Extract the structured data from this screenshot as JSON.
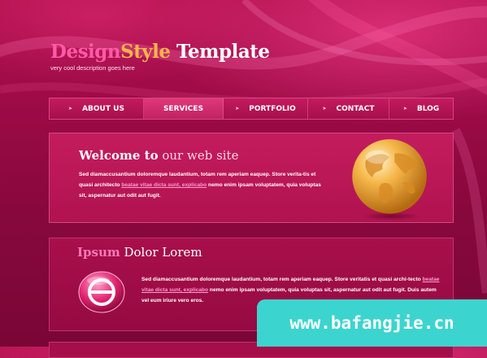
{
  "header": {
    "logo_part1": "Design",
    "logo_part2": "Style",
    "logo_part3": " Template",
    "tagline": "very cool description goes here"
  },
  "nav": {
    "items": [
      {
        "label": "ABOUT US"
      },
      {
        "label": "SERVICES",
        "active": true
      },
      {
        "label": "PORTFOLIO"
      },
      {
        "label": "CONTACT"
      },
      {
        "label": "BLOG"
      }
    ]
  },
  "welcome": {
    "title_bold": "Welcome to",
    "title_light": " our web site",
    "text_before": "Sed diamaccusantium doloremque laudantium, totam rem aperiam eaquep. Store verita-tis et quasi architecto ",
    "link": "beatae vitae dicta sunt, explicabo",
    "text_after": " nemo enim ipsam voluptatem, quia voluptas sit, aspernatur aut odit aut fugit."
  },
  "ipsum": {
    "title_bold": "Ipsum",
    "title_light": " Dolor Lorem",
    "text_before": "Sed diamaccusantium doloremque laudantium, totam rem aperiam eaquep. Store veritatis et quasi archi-tecto ",
    "link": "beatae vitae dicta sunt, explicabo",
    "text_after": " nemo enim ipsam voluptatem, quia voluptas sit, aspernatur aut odit aut fugit. Duis autem vel eum iriure vero eros."
  },
  "watermark": "www.bafangjie.cn",
  "colors": {
    "background": "#9a0a45",
    "logo_pink": "#ff5aa8",
    "logo_orange": "#f6b64a",
    "link": "#ff9ad0",
    "watermark_bg": "#3cd4cf"
  },
  "icons": {
    "globe": "globe-icon",
    "badge": "theta-badge-icon",
    "nav_arrow": "arrow-right-icon"
  }
}
